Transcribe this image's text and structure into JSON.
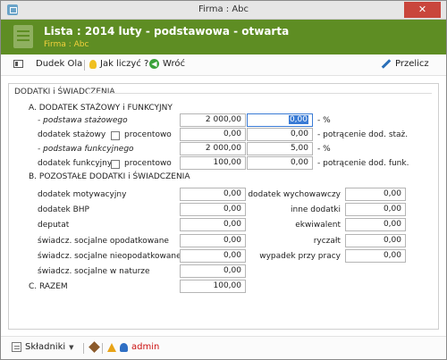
{
  "window": {
    "title": "Firma : Abc",
    "close_glyph": "✕"
  },
  "header": {
    "title": "Lista : 2014 luty - podstawowa - otwarta",
    "subtitle": "Firma : Abc"
  },
  "toolbar": {
    "employee": "Dudek Ola",
    "how_to_calc": "Jak liczyć ?",
    "back": "Wróć",
    "recalc": "Przelicz"
  },
  "panel": {
    "title": "DODATKI i ŚWIADCZENIA",
    "sectionA": {
      "title": "A. DODATEK STAŻOWY i FUNKCYJNY",
      "rows": [
        {
          "label": "- podstawa stażowego",
          "value": "2 000,00",
          "percent": "0,00",
          "suffix": "- %"
        },
        {
          "label": "dodatek stażowy",
          "checkbox_label": "procentowo",
          "value": "0,00",
          "percent": "0,00",
          "suffix": "- potrącenie dod. staż."
        },
        {
          "label": "- podstawa funkcyjnego",
          "value": "2 000,00",
          "percent": "5,00",
          "suffix": "- %"
        },
        {
          "label": "dodatek funkcyjny",
          "checkbox_label": "procentowo",
          "value": "100,00",
          "percent": "0,00",
          "suffix": "- potrącenie dod. funk."
        }
      ]
    },
    "sectionB": {
      "title": "B. POZOSTAŁE DODATKI i ŚWIADCZENIA",
      "left": [
        {
          "label": "dodatek motywacyjny",
          "value": "0,00"
        },
        {
          "label": "dodatek BHP",
          "value": "0,00"
        },
        {
          "label": "deputat",
          "value": "0,00"
        },
        {
          "label": "świadcz. socjalne opodatkowane",
          "value": "0,00"
        },
        {
          "label": "świadcz. socjalne nieopodatkowane",
          "value": "0,00"
        },
        {
          "label": "świadcz. socjalne w naturze",
          "value": "0,00"
        }
      ],
      "right": [
        {
          "label": "dodatek wychowawczy",
          "value": "0,00"
        },
        {
          "label": "inne dodatki",
          "value": "0,00"
        },
        {
          "label": "ekwiwalent",
          "value": "0,00"
        },
        {
          "label": "ryczałt",
          "value": "0,00"
        },
        {
          "label": "wypadek przy pracy",
          "value": "0,00"
        }
      ]
    },
    "sectionC": {
      "title": "C. RAZEM",
      "value": "100,00"
    }
  },
  "statusbar": {
    "components": "Składniki",
    "user": "admin"
  },
  "colors": {
    "header_bg": "#5e8d23",
    "subtitle": "#f2d13c",
    "close": "#c9463c",
    "user": "#cc1111"
  },
  "icons": [
    "app-icon",
    "close-icon",
    "document-icon",
    "id-card-icon",
    "lightbulb-icon",
    "back-arrow-icon",
    "pen-icon",
    "list-icon",
    "chevron-down-icon",
    "brush-icon",
    "warning-icon",
    "user-icon"
  ]
}
